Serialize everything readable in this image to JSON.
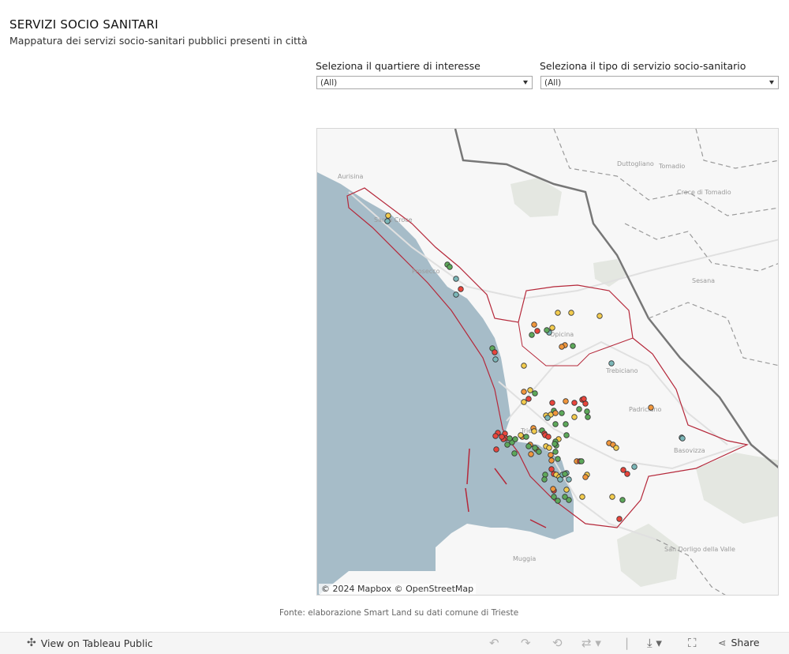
{
  "header": {
    "title": "SERVIZI SOCIO SANITARI",
    "subtitle": "Mappatura dei servizi socio-sanitari pubblici presenti in città"
  },
  "filters": {
    "quartiere": {
      "label": "Seleziona il quartiere di interesse",
      "value": "(All)"
    },
    "servizio": {
      "label": "Seleziona il tipo di servizio socio-sanitario",
      "value": "(All)"
    }
  },
  "map": {
    "attribution": "© 2024 Mapbox  © OpenStreetMap",
    "place_labels": [
      "Aurisina",
      "Santa Croce",
      "Prosecco",
      "Opicina",
      "Trebiciano",
      "Padriciano",
      "Basovizza",
      "Sesana",
      "Duttogliano",
      "Tomadio",
      "Croce di Tomadio",
      "Muggia",
      "San Dorligo della Valle",
      "Trieste"
    ],
    "colors": {
      "sea": "#a6bcc8",
      "land": "#f7f7f7",
      "boundary": "#b5283a",
      "red": "#e8453c",
      "orange": "#f0963c",
      "yellow": "#f2cb4e",
      "green": "#5da85a",
      "teal": "#7bb7b8"
    }
  },
  "footer": {
    "source": "Fonte: elaborazione Smart Land su dati comune di Trieste"
  },
  "toolbar": {
    "view_label": "View on Tableau Public",
    "share_label": "Share",
    "icons": [
      "tableau-icon",
      "undo-icon",
      "redo-icon",
      "revert-icon",
      "refresh-icon",
      "download-icon",
      "fullscreen-icon",
      "share-icon"
    ]
  }
}
